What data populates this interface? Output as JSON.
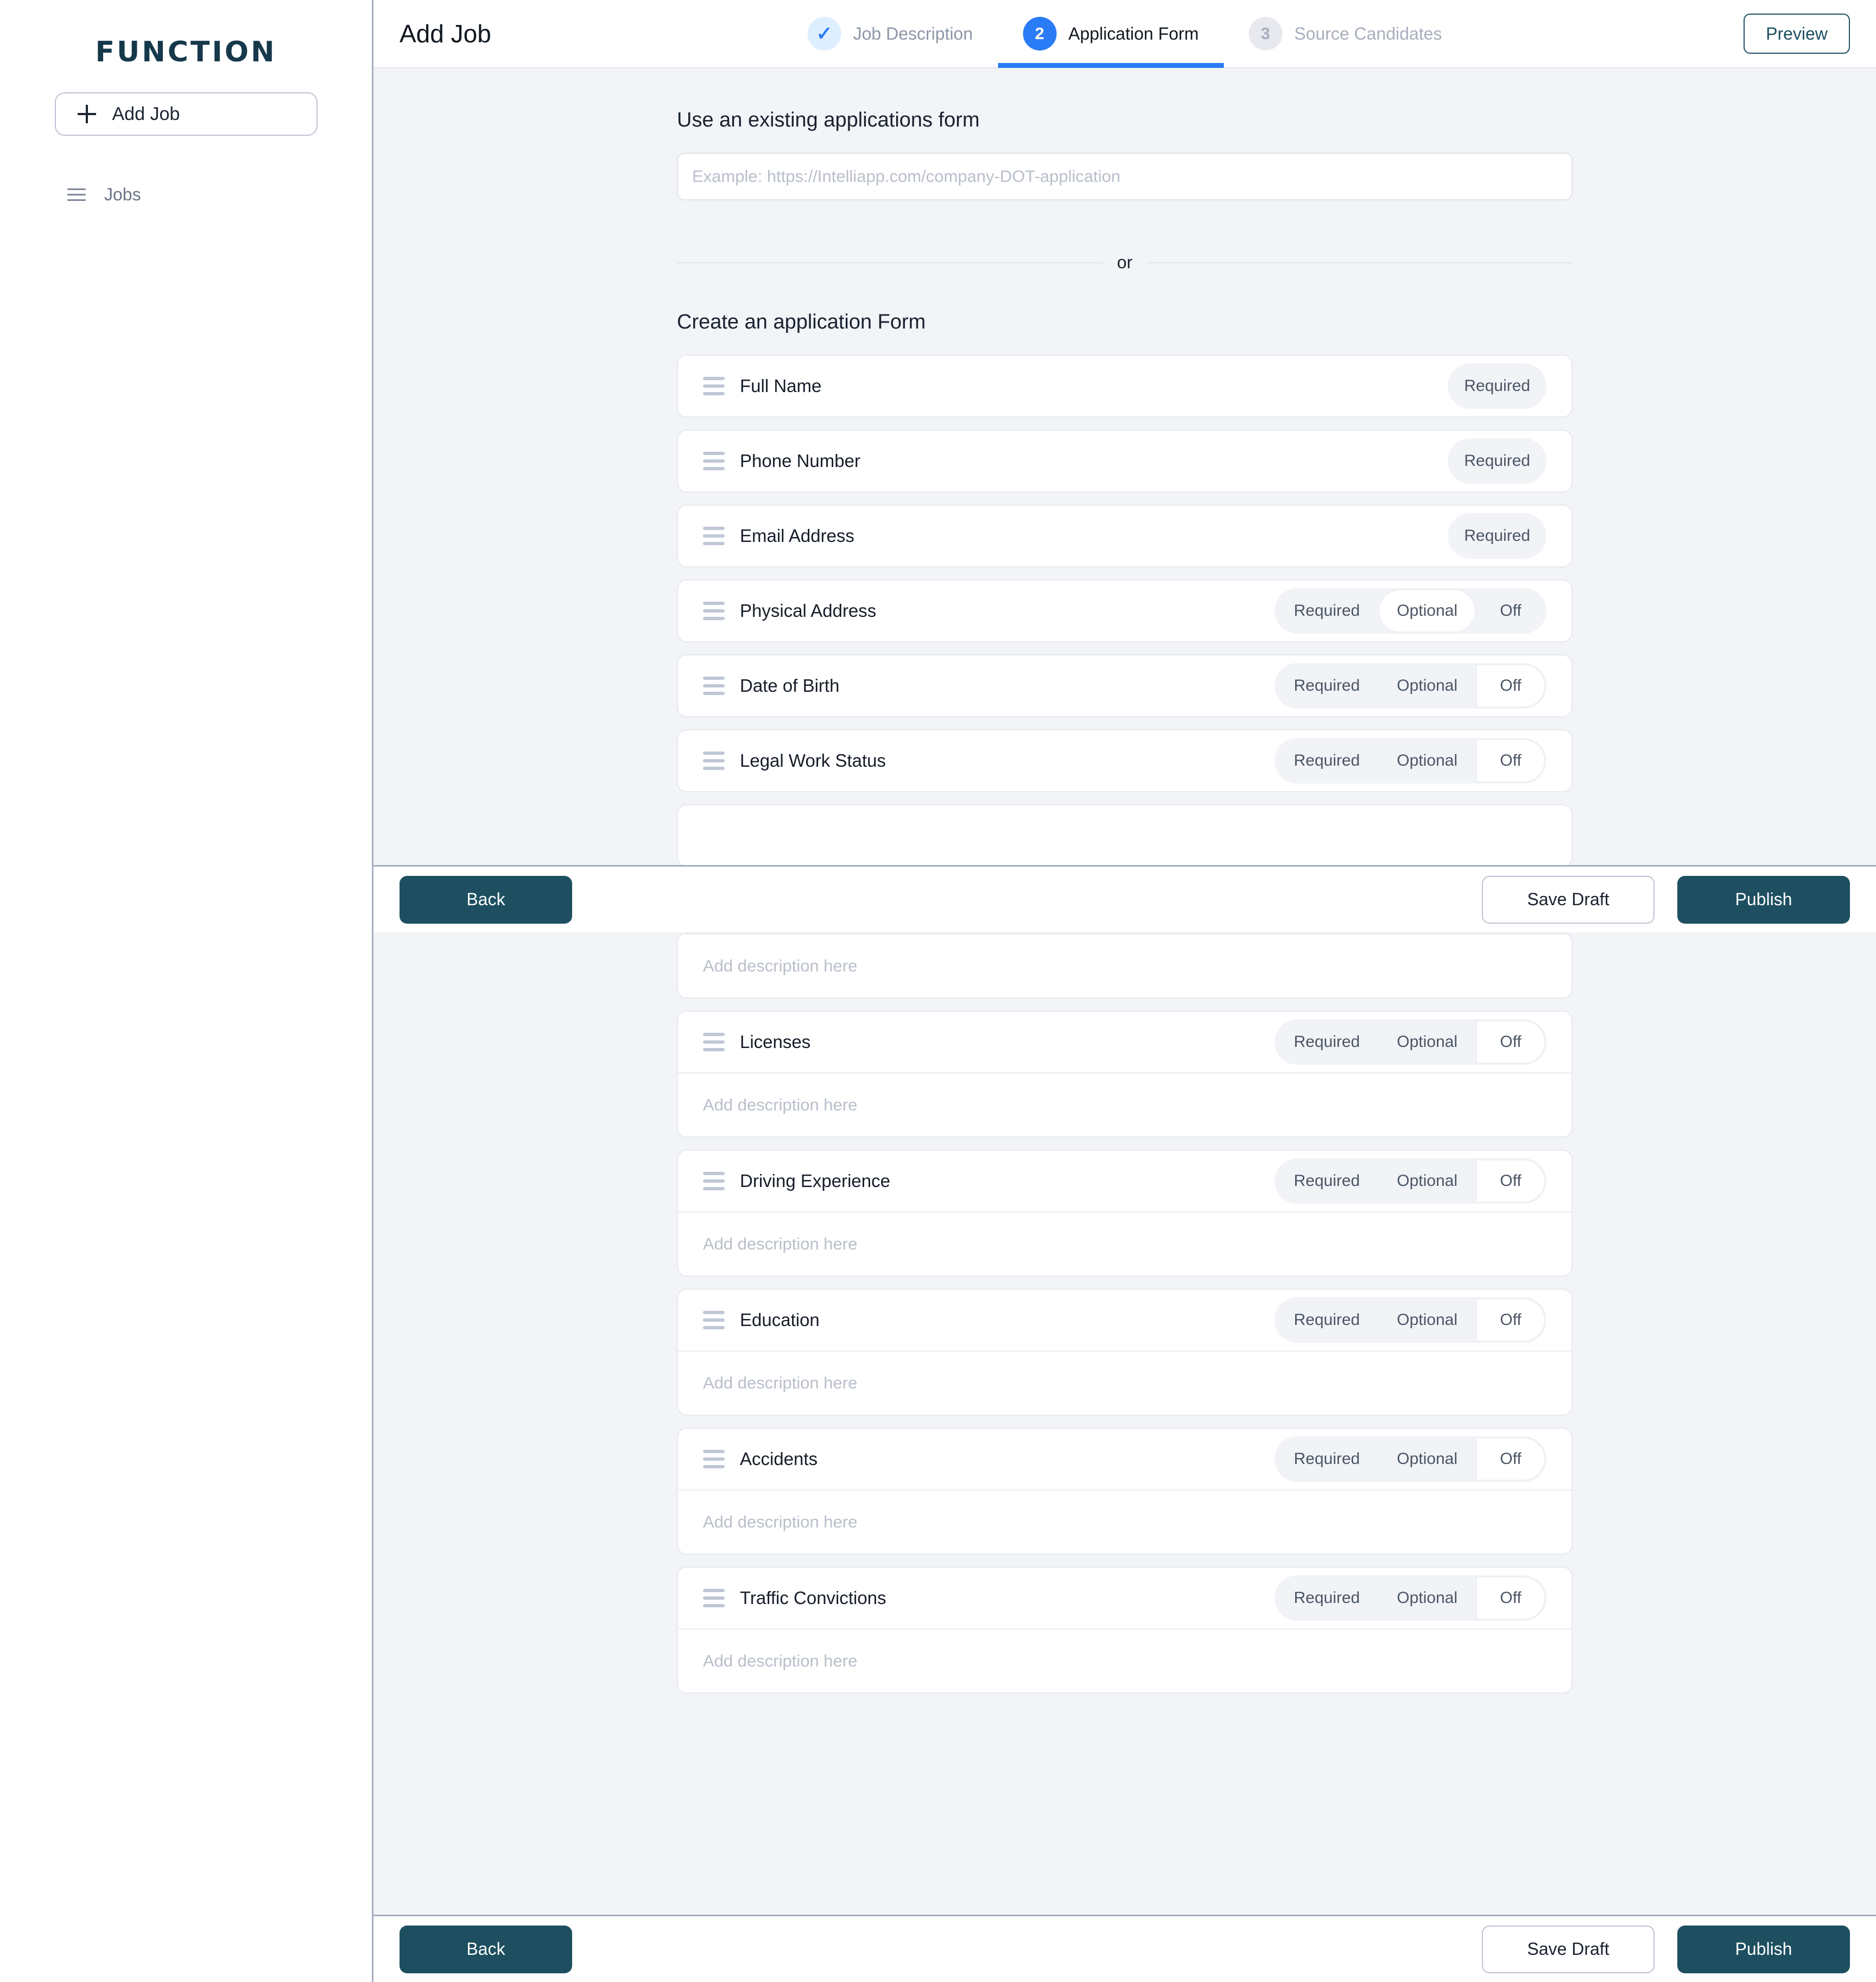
{
  "sidebar": {
    "brand": "FUNCTION",
    "add_job_button": "Add Job",
    "items": [
      {
        "label": "Jobs",
        "icon": "hamburger-icon"
      }
    ]
  },
  "header": {
    "title": "Add Job",
    "preview_button": "Preview",
    "steps": [
      {
        "badge": "✓",
        "label": "Job Description",
        "state": "done"
      },
      {
        "badge": "2",
        "label": "Application Form",
        "state": "active"
      },
      {
        "badge": "3",
        "label": "Source Candidates",
        "state": "todo"
      }
    ]
  },
  "main": {
    "existing_form": {
      "heading": "Use an existing applications form",
      "input_value": "",
      "input_placeholder": "Example: https://Intelliapp.com/company-DOT-application"
    },
    "or_text": "or",
    "create_form": {
      "heading": "Create an application Form",
      "segment_options": [
        "Required",
        "Optional",
        "Off"
      ],
      "description_placeholder": "Add description here",
      "fields": [
        {
          "label": "Full Name",
          "control": "locked",
          "selected": "Required",
          "has_description": false
        },
        {
          "label": "Phone Number",
          "control": "locked",
          "selected": "Required",
          "has_description": false
        },
        {
          "label": "Email Address",
          "control": "locked",
          "selected": "Required",
          "has_description": false
        },
        {
          "label": "Physical Address",
          "control": "segmented",
          "selected": "Optional",
          "has_description": false
        },
        {
          "label": "Date of Birth",
          "control": "segmented",
          "selected": "Off",
          "has_description": false
        },
        {
          "label": "Legal Work Status",
          "control": "segmented",
          "selected": "Off",
          "has_description": false
        }
      ],
      "fields_lower": [
        {
          "label": "Licenses",
          "control": "segmented",
          "selected": "Off",
          "has_description": true
        },
        {
          "label": "Driving Experience",
          "control": "segmented",
          "selected": "Off",
          "has_description": true
        },
        {
          "label": "Education",
          "control": "segmented",
          "selected": "Off",
          "has_description": true
        },
        {
          "label": "Accidents",
          "control": "segmented",
          "selected": "Off",
          "has_description": true
        },
        {
          "label": "Traffic Convictions",
          "control": "segmented",
          "selected": "Off",
          "has_description": true
        }
      ]
    }
  },
  "action_bar": {
    "back": "Back",
    "save_draft": "Save Draft",
    "publish": "Publish"
  },
  "colors": {
    "accent_blue": "#2a7bf6",
    "brand_dark": "#16384b",
    "button_teal": "#1d4f61",
    "page_bg": "#f2f4f7"
  }
}
